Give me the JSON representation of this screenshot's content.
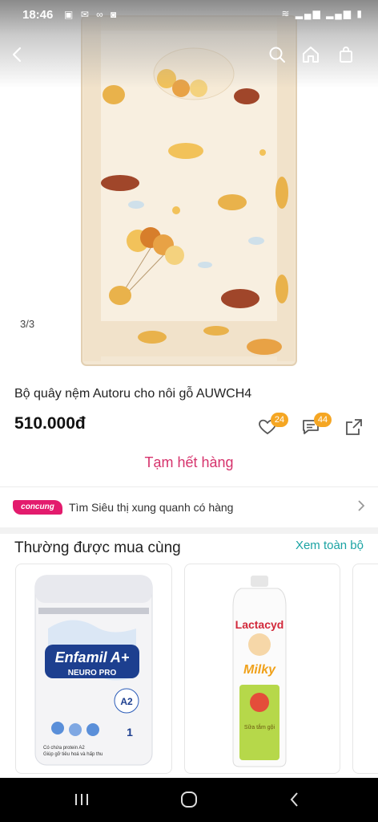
{
  "status_bar": {
    "time": "18:46",
    "left_icons": [
      "image-icon",
      "mail-icon",
      "link-icon",
      "app-icon"
    ],
    "right_icons": [
      "wifi-icon",
      "signal-icon",
      "signal-icon",
      "battery-icon"
    ]
  },
  "header": {
    "back_icon": "chevron-left-icon",
    "search_icon": "search-icon",
    "home_icon": "home-icon",
    "cart_icon": "shopping-bag-icon"
  },
  "gallery": {
    "counter": "3/3"
  },
  "product": {
    "title": "Bộ quây nệm Autoru cho nôi gỗ AUWCH4",
    "price": "510.000đ",
    "likes_count": "24",
    "comments_count": "44",
    "status_button": "Tạm hết hàng"
  },
  "store_finder": {
    "logo_text": "concung",
    "text": "Tìm Siêu thị xung quanh có hàng"
  },
  "bought_together": {
    "title": "Thường được mua cùng",
    "see_all": "Xem toàn bộ",
    "items": [
      {
        "brand": "Enfamil A+",
        "line": "NEURO PRO",
        "tag": "A2",
        "stage": "1",
        "note": "Có chứa protein A2",
        "note2": "Giúp gỡ tiêu hoá và hấp thu"
      },
      {
        "brand": "Lactacyd",
        "line": "Milky",
        "note": "Sữa tắm gội"
      }
    ]
  },
  "colors": {
    "accent_pink": "#d6336c",
    "accent_teal": "#1aa3a3",
    "badge_orange": "#f5a623",
    "brand_pink": "#e31b6d"
  }
}
